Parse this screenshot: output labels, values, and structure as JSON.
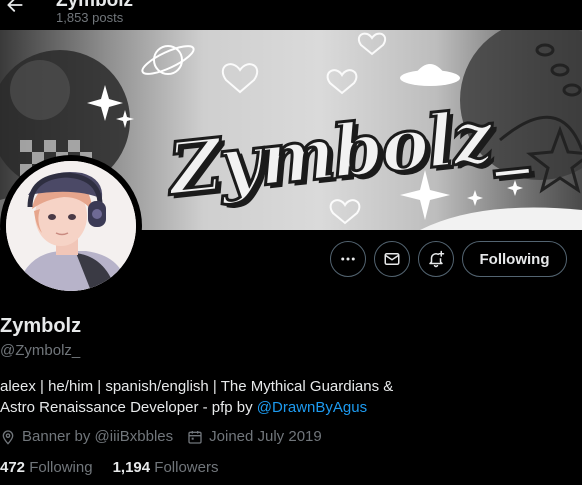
{
  "header": {
    "display_name": "Zymbolz",
    "post_count": "1,853 posts"
  },
  "banner": {
    "wordmark": "Zymbolz_"
  },
  "actions": {
    "more_icon": "more-horizontal-icon",
    "message_icon": "envelope-icon",
    "notify_icon": "bell-plus-icon",
    "follow_label": "Following"
  },
  "profile": {
    "name": "Zymbolz",
    "handle": "@Zymbolz_",
    "bio_line1": "aleex | he/him | spanish/english | The Mythical Guardians &",
    "bio_line2_prefix": "Astro Renaissance Developer - pfp by ",
    "bio_mention": "@DrawnByAgus",
    "location": "Banner by @iiiBxbbles",
    "joined": "Joined July 2019",
    "following_count": "472",
    "following_label": "Following",
    "followers_count": "1,194",
    "followers_label": "Followers"
  },
  "colors": {
    "background": "#000000",
    "text": "#e7e9ea",
    "muted": "#71767b",
    "link": "#1d9bf0",
    "border": "#536471"
  }
}
